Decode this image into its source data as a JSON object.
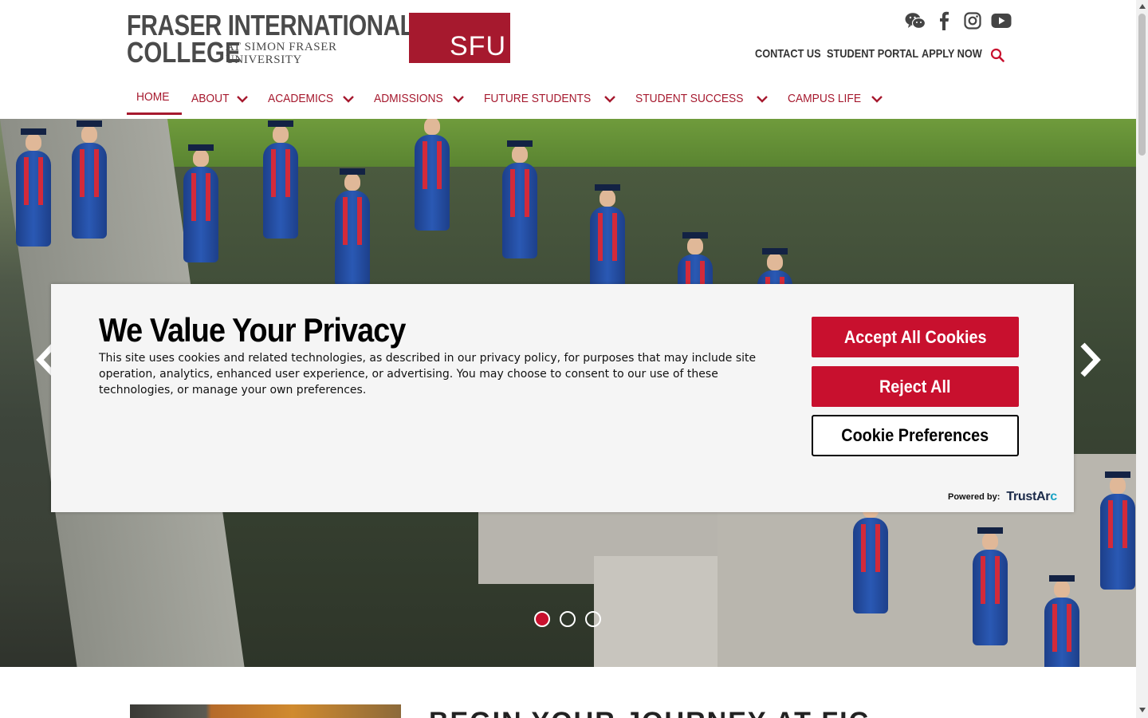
{
  "brand": {
    "logo_line1": "FRASER INTERNATIONAL",
    "logo_line2": "COLLEGE",
    "logo_line3a": "AT SIMON FRASER",
    "logo_line3b": "UNIVERSITY",
    "sfu_mark": "SFU",
    "accent": "#a6192e"
  },
  "social_icons": [
    "wechat-icon",
    "facebook-icon",
    "instagram-icon",
    "youtube-icon"
  ],
  "utility_nav": {
    "contact": "CONTACT US",
    "portal": "STUDENT PORTAL",
    "apply": "APPLY NOW"
  },
  "main_nav": [
    {
      "label": "HOME",
      "active": true
    },
    {
      "label": "ABOUT"
    },
    {
      "label": "ACADEMICS"
    },
    {
      "label": "ADMISSIONS"
    },
    {
      "label": "FUTURE STUDENTS"
    },
    {
      "label": "STUDENT SUCCESS"
    },
    {
      "label": "CAMPUS LIFE"
    }
  ],
  "carousel": {
    "slides": 3,
    "active_index": 0
  },
  "cookie_banner": {
    "title": "We Value Your Privacy",
    "body": "This site uses cookies and related technologies, as described in our privacy policy, for purposes that may include site operation, analytics, enhanced user experience, or advertising. You may choose to consent to our use of these technologies, or manage your own preferences.",
    "accept_label": "Accept All Cookies",
    "reject_label": "Reject All",
    "prefs_label": "Cookie Preferences",
    "powered_by": "Powered by:",
    "vendor_a": "TrustAr",
    "vendor_b": "c",
    "primary_color": "#c8102e"
  },
  "below": {
    "heading": "BEGIN YOUR JOURNEY AT FIC"
  }
}
